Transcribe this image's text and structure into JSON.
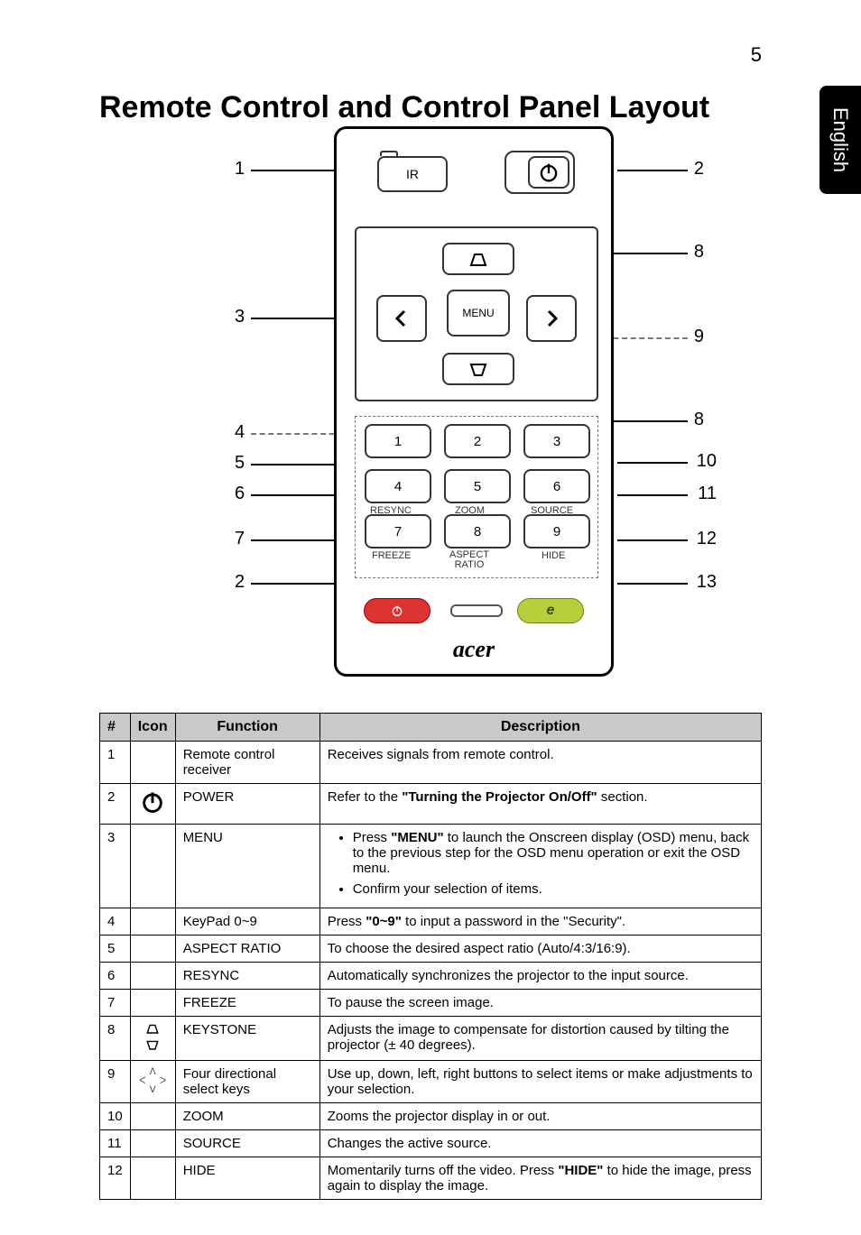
{
  "page_number": "5",
  "side_tab": "English",
  "title": "Remote Control and Control Panel Layout",
  "remote": {
    "ir_label": "IR",
    "menu_label": "MENU",
    "btn1": "1",
    "btn2": "2",
    "btn3": "3",
    "btn4": "4",
    "btn5": "5",
    "btn6": "6",
    "btn7": "7",
    "btn8": "8",
    "btn9": "9",
    "sub_resync": "RESYNC",
    "sub_zoom": "ZOOM",
    "sub_source": "SOURCE",
    "sub_freeze": "FREEZE",
    "sub_aspect": "ASPECT\nRATIO",
    "sub_hide": "HIDE",
    "brand": "acer",
    "callouts": {
      "c1": "1",
      "c2": "2",
      "c3": "3",
      "c4": "4",
      "c5": "5",
      "c6": "6",
      "c7": "7",
      "c2b": "2",
      "c8": "8",
      "c9": "9",
      "c8b": "8",
      "c10": "10",
      "c11": "11",
      "c12": "12",
      "c13": "13"
    }
  },
  "table": {
    "head": {
      "num": "#",
      "icon": "Icon",
      "func": "Function",
      "desc": "Description"
    },
    "rows": [
      {
        "n": "1",
        "icon": "",
        "func": "Remote control receiver",
        "desc_plain": "Receives signals from remote control."
      },
      {
        "n": "2",
        "icon": "power",
        "func": "POWER",
        "desc_pre": "Refer to the ",
        "desc_bold": "\"Turning the Projector On/Off\"",
        "desc_post": " section."
      },
      {
        "n": "3",
        "icon": "",
        "func": "MENU",
        "bullets": [
          {
            "pre": "Press ",
            "bold": "\"MENU\"",
            "post": " to launch the Onscreen display (OSD) menu, back to the previous step for the OSD menu operation or exit the OSD menu."
          },
          {
            "plain": "Confirm your selection of items."
          }
        ]
      },
      {
        "n": "4",
        "icon": "",
        "func": "KeyPad 0~9",
        "desc_pre": "Press ",
        "desc_bold": "\"0~9\"",
        "desc_post": " to input a password in the \"Security\"."
      },
      {
        "n": "5",
        "icon": "",
        "func": "ASPECT RATIO",
        "desc_plain": "To choose the desired aspect ratio (Auto/4:3/16:9)."
      },
      {
        "n": "6",
        "icon": "",
        "func": "RESYNC",
        "desc_plain": "Automatically synchronizes the projector to the input source."
      },
      {
        "n": "7",
        "icon": "",
        "func": "FREEZE",
        "desc_plain": "To pause the screen image."
      },
      {
        "n": "8",
        "icon": "keystone",
        "func": "KEYSTONE",
        "desc_plain": "Adjusts the image to compensate for distortion caused by tilting the projector (± 40 degrees)."
      },
      {
        "n": "9",
        "icon": "directional",
        "func": "Four directional select keys",
        "desc_plain": "Use up, down, left, right buttons to select items or make adjustments to your selection."
      },
      {
        "n": "10",
        "icon": "",
        "func": "ZOOM",
        "desc_plain": "Zooms the projector display in or out."
      },
      {
        "n": "11",
        "icon": "",
        "func": "SOURCE",
        "desc_plain": "Changes the active source."
      },
      {
        "n": "12",
        "icon": "",
        "func": "HIDE",
        "desc_pre": "Momentarily turns off the video. Press ",
        "desc_bold": "\"HIDE\"",
        "desc_post": " to hide the image, press again to display the image."
      }
    ]
  }
}
